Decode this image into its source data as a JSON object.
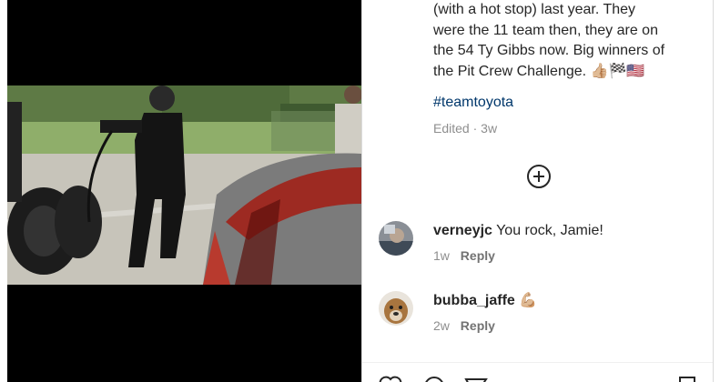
{
  "post": {
    "caption_lines": [
      "(with a hot stop) last year. They",
      "were the 11 team then, they are on",
      "the 54 Ty Gibbs now. Big winners of",
      "the Pit Crew Challenge. 👍🏼🏁🇺🇸"
    ],
    "hashtag": "#teamtoyota",
    "edited_label": "Edited",
    "separator": "·",
    "age": "3w"
  },
  "comments": [
    {
      "username": "verneyjc",
      "text": "You rock, Jamie!",
      "age": "1w",
      "reply_label": "Reply"
    },
    {
      "username": "bubba_jaffe",
      "text": "💪🏼",
      "age": "2w",
      "reply_label": "Reply"
    }
  ],
  "icons": {
    "load_more": "plus-circle-icon",
    "like": "heart-icon",
    "comment": "comment-icon",
    "share": "share-icon",
    "save": "bookmark-icon"
  },
  "colors": {
    "text": "#262626",
    "secondary": "#8e8e8e",
    "link": "#00376b",
    "divider": "#dbdbdb"
  }
}
